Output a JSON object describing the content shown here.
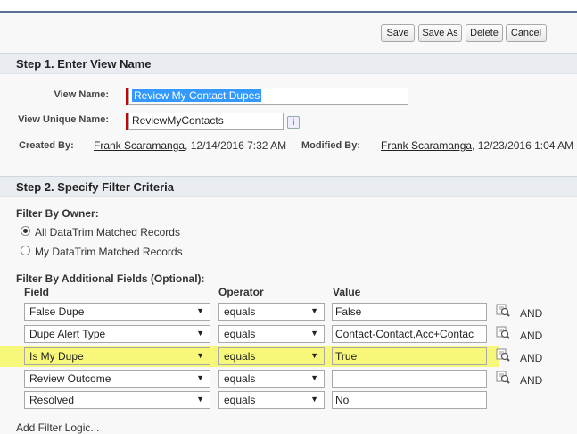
{
  "toolbar": {
    "save": "Save",
    "save_as": "Save As",
    "delete": "Delete",
    "cancel": "Cancel"
  },
  "step1": {
    "title": "Step 1. Enter View Name",
    "view_name_label": "View Name:",
    "view_name_value": "Review My Contact Dupes",
    "unique_name_label": "View Unique Name:",
    "unique_name_value": "ReviewMyContacts",
    "info_icon": "i",
    "created_by_label": "Created By:",
    "created_by_user": "Frank Scaramanga",
    "created_by_date": ", 12/14/2016 7:32 AM",
    "modified_by_label": "Modified By:",
    "modified_by_user": "Frank Scaramanga",
    "modified_by_date": ", 12/23/2016 1:04 AM"
  },
  "step2": {
    "title": "Step 2. Specify Filter Criteria",
    "filter_owner_label": "Filter By Owner:",
    "owner_options": [
      {
        "label": "All DataTrim Matched Records",
        "selected": true
      },
      {
        "label": "My DataTrim Matched Records",
        "selected": false
      }
    ],
    "additional_label": "Filter By Additional Fields (Optional):",
    "col_field": "Field",
    "col_operator": "Operator",
    "col_value": "Value",
    "rows": [
      {
        "field": "False Dupe",
        "operator": "equals",
        "value": "False",
        "and": "AND"
      },
      {
        "field": "Dupe Alert Type",
        "operator": "equals",
        "value": "Contact-Contact,Acc+Contac",
        "and": "AND"
      },
      {
        "field": "Is My Dupe",
        "operator": "equals",
        "value": "True",
        "and": "AND"
      },
      {
        "field": "Review Outcome",
        "operator": "equals",
        "value": "",
        "and": "AND"
      },
      {
        "field": "Resolved",
        "operator": "equals",
        "value": "No",
        "and": ""
      }
    ],
    "add_filter_logic": "Add Filter Logic..."
  },
  "colors": {
    "highlight": "#f7f77a",
    "section_bar": "#e9edf2",
    "required_marker": "#cc0000",
    "selection": "#3399ff"
  }
}
